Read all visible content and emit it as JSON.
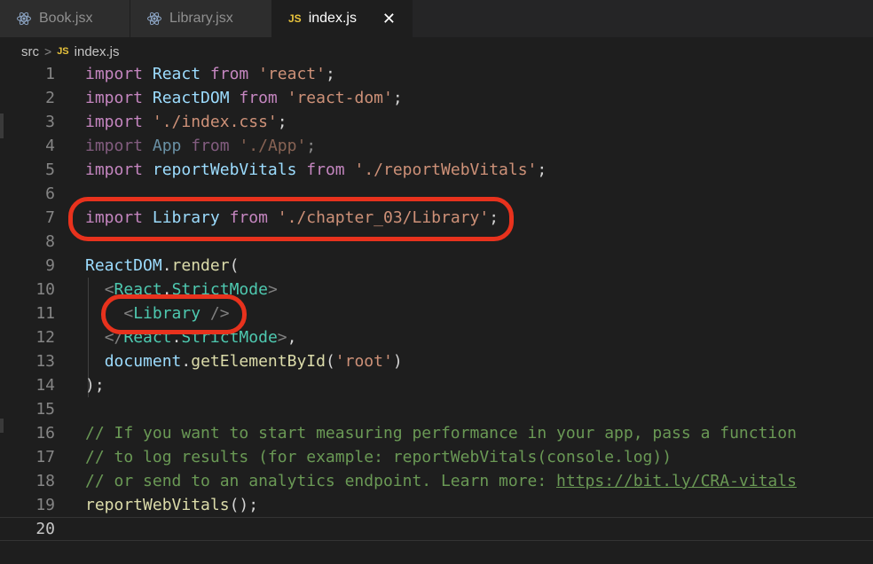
{
  "tabs": [
    {
      "label": "Book.jsx",
      "icon": "react-icon",
      "active": false
    },
    {
      "label": "Library.jsx",
      "icon": "react-icon",
      "active": false
    },
    {
      "label": "index.js",
      "icon": "js-icon",
      "badge": "JS",
      "active": true
    }
  ],
  "breadcrumb": {
    "folder": "src",
    "separator": ">",
    "file_badge": "JS",
    "file": "index.js"
  },
  "editor": {
    "line_numbers": [
      "1",
      "2",
      "3",
      "4",
      "5",
      "6",
      "7",
      "8",
      "9",
      "10",
      "11",
      "12",
      "13",
      "14",
      "15",
      "16",
      "17",
      "18",
      "19",
      "20"
    ],
    "current_line": 20,
    "lines": [
      [
        [
          "kw",
          "import"
        ],
        [
          "pun",
          " "
        ],
        [
          "var",
          "React"
        ],
        [
          "pun",
          " "
        ],
        [
          "kw",
          "from"
        ],
        [
          "pun",
          " "
        ],
        [
          "str",
          "'react'"
        ],
        [
          "pun",
          ";"
        ]
      ],
      [
        [
          "kw",
          "import"
        ],
        [
          "pun",
          " "
        ],
        [
          "var",
          "ReactDOM"
        ],
        [
          "pun",
          " "
        ],
        [
          "kw",
          "from"
        ],
        [
          "pun",
          " "
        ],
        [
          "str",
          "'react-dom'"
        ],
        [
          "pun",
          ";"
        ]
      ],
      [
        [
          "kw",
          "import"
        ],
        [
          "pun",
          " "
        ],
        [
          "str",
          "'./index.css'"
        ],
        [
          "pun",
          ";"
        ]
      ],
      [
        [
          "kw dim",
          "import"
        ],
        [
          "pun dim",
          " "
        ],
        [
          "var dim",
          "App"
        ],
        [
          "pun dim",
          " "
        ],
        [
          "kw dim",
          "from"
        ],
        [
          "pun dim",
          " "
        ],
        [
          "str dim",
          "'./App'"
        ],
        [
          "pun dim",
          ";"
        ]
      ],
      [
        [
          "kw",
          "import"
        ],
        [
          "pun",
          " "
        ],
        [
          "var",
          "reportWebVitals"
        ],
        [
          "pun",
          " "
        ],
        [
          "kw",
          "from"
        ],
        [
          "pun",
          " "
        ],
        [
          "str",
          "'./reportWebVitals'"
        ],
        [
          "pun",
          ";"
        ]
      ],
      [],
      [
        [
          "kw",
          "import"
        ],
        [
          "pun",
          " "
        ],
        [
          "var",
          "Library"
        ],
        [
          "pun",
          " "
        ],
        [
          "kw",
          "from"
        ],
        [
          "pun",
          " "
        ],
        [
          "str",
          "'./chapter_03/Library'"
        ],
        [
          "pun",
          ";"
        ]
      ],
      [],
      [
        [
          "var",
          "ReactDOM"
        ],
        [
          "pun",
          "."
        ],
        [
          "fn",
          "render"
        ],
        [
          "pun",
          "("
        ]
      ],
      [
        [
          "pun",
          "  "
        ],
        [
          "brk",
          "<"
        ],
        [
          "tag",
          "React"
        ],
        [
          "pun",
          "."
        ],
        [
          "tag",
          "StrictMode"
        ],
        [
          "brk",
          ">"
        ]
      ],
      [
        [
          "pun",
          "    "
        ],
        [
          "brk",
          "<"
        ],
        [
          "tag",
          "Library"
        ],
        [
          "pun",
          " "
        ],
        [
          "brk",
          "/>"
        ]
      ],
      [
        [
          "pun",
          "  "
        ],
        [
          "brk",
          "</"
        ],
        [
          "tag",
          "React"
        ],
        [
          "pun",
          "."
        ],
        [
          "tag",
          "StrictMode"
        ],
        [
          "brk",
          ">"
        ],
        [
          "pun",
          ","
        ]
      ],
      [
        [
          "pun",
          "  "
        ],
        [
          "var",
          "document"
        ],
        [
          "pun",
          "."
        ],
        [
          "fn",
          "getElementById"
        ],
        [
          "pun",
          "("
        ],
        [
          "str",
          "'root'"
        ],
        [
          "pun",
          ")"
        ]
      ],
      [
        [
          "pun",
          ");"
        ]
      ],
      [],
      [
        [
          "cm",
          "// If you want to start measuring performance in your app, pass a function"
        ]
      ],
      [
        [
          "cm",
          "// to log results (for example: reportWebVitals(console.log))"
        ]
      ],
      [
        [
          "cm",
          "// or send to an analytics endpoint. Learn more: "
        ],
        [
          "link",
          "https://bit.ly/CRA-vitals"
        ]
      ],
      [
        [
          "fn",
          "reportWebVitals"
        ],
        [
          "pun",
          "();"
        ]
      ],
      []
    ]
  },
  "colors": {
    "editor_bg": "#1e1e1e",
    "tabbar_bg": "#252526",
    "annotation": "#e8321d",
    "keyword": "#c586c0",
    "variable": "#9cdcfe",
    "string": "#ce9178",
    "function": "#dcdcaa",
    "jsx_tag": "#4ec9b0",
    "comment": "#6a9955"
  }
}
